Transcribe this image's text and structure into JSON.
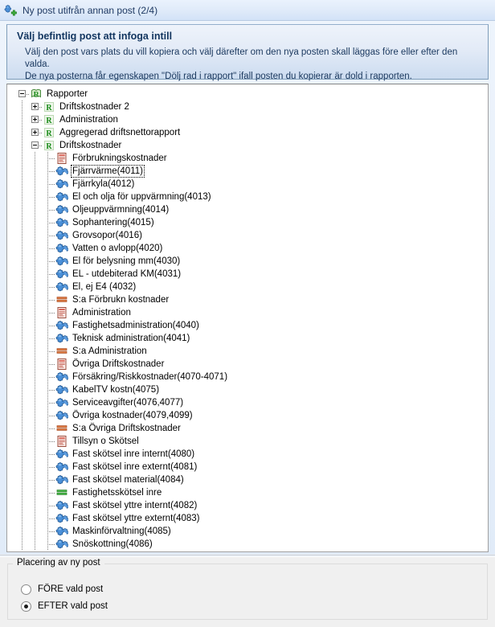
{
  "window": {
    "title": "Ny post utifrån annan post (2/4)",
    "icon": "puzzle-plus-icon"
  },
  "header": {
    "title": "Välj befintlig post att infoga intill",
    "line1": "Välj den post vars plats du vill kopiera och välj därefter om den nya posten skall läggas före eller efter den valda.",
    "line2": "De nya posterna får egenskapen \"Dölj rad i rapport\" ifall posten du kopierar är dold i rapporten."
  },
  "tree": {
    "nodes": [
      {
        "label": "Rapporter",
        "depth": 0,
        "icon": "report-root-icon",
        "expander": "minus",
        "focused": false
      },
      {
        "label": "Driftskostnader 2",
        "depth": 1,
        "icon": "report-icon",
        "expander": "plus",
        "focused": false
      },
      {
        "label": "Administration",
        "depth": 1,
        "icon": "report-icon",
        "expander": "plus",
        "focused": false
      },
      {
        "label": "Aggregerad driftsnettorapport",
        "depth": 1,
        "icon": "report-icon",
        "expander": "plus",
        "focused": false
      },
      {
        "label": "Driftskostnader",
        "depth": 1,
        "icon": "report-icon",
        "expander": "minus",
        "focused": false
      },
      {
        "label": "Förbrukningskostnader",
        "depth": 2,
        "icon": "doc-icon",
        "expander": "none",
        "focused": false
      },
      {
        "label": "Fjärrvärme(4011)",
        "depth": 2,
        "icon": "puzzle-icon",
        "expander": "none",
        "focused": true
      },
      {
        "label": "Fjärrkyla(4012)",
        "depth": 2,
        "icon": "puzzle-icon",
        "expander": "none",
        "focused": false
      },
      {
        "label": "El och olja för uppvärmning(4013)",
        "depth": 2,
        "icon": "puzzle-icon",
        "expander": "none",
        "focused": false
      },
      {
        "label": "Oljeuppvärmning(4014)",
        "depth": 2,
        "icon": "puzzle-icon",
        "expander": "none",
        "focused": false
      },
      {
        "label": "Sophantering(4015)",
        "depth": 2,
        "icon": "puzzle-icon",
        "expander": "none",
        "focused": false
      },
      {
        "label": "Grovsopor(4016)",
        "depth": 2,
        "icon": "puzzle-icon",
        "expander": "none",
        "focused": false
      },
      {
        "label": "Vatten o avlopp(4020)",
        "depth": 2,
        "icon": "puzzle-icon",
        "expander": "none",
        "focused": false
      },
      {
        "label": "El för belysning mm(4030)",
        "depth": 2,
        "icon": "puzzle-icon",
        "expander": "none",
        "focused": false
      },
      {
        "label": "EL - utdebiterad KM(4031)",
        "depth": 2,
        "icon": "puzzle-icon",
        "expander": "none",
        "focused": false
      },
      {
        "label": "El, ej E4 (4032)",
        "depth": 2,
        "icon": "puzzle-icon",
        "expander": "none",
        "focused": false
      },
      {
        "label": "S:a Förbrukn kostnader",
        "depth": 2,
        "icon": "sum-icon",
        "expander": "none",
        "focused": false
      },
      {
        "label": "Administration",
        "depth": 2,
        "icon": "doc-icon",
        "expander": "none",
        "focused": false
      },
      {
        "label": "Fastighetsadministration(4040)",
        "depth": 2,
        "icon": "puzzle-icon",
        "expander": "none",
        "focused": false
      },
      {
        "label": "Teknisk administration(4041)",
        "depth": 2,
        "icon": "puzzle-icon",
        "expander": "none",
        "focused": false
      },
      {
        "label": "S:a Administration",
        "depth": 2,
        "icon": "sum-icon",
        "expander": "none",
        "focused": false
      },
      {
        "label": "Övriga Driftskostnader",
        "depth": 2,
        "icon": "doc-icon",
        "expander": "none",
        "focused": false
      },
      {
        "label": "Försäkring/Riskkostnader(4070-4071)",
        "depth": 2,
        "icon": "puzzle-icon",
        "expander": "none",
        "focused": false
      },
      {
        "label": "KabelTV kostn(4075)",
        "depth": 2,
        "icon": "puzzle-icon",
        "expander": "none",
        "focused": false
      },
      {
        "label": "Serviceavgifter(4076,4077)",
        "depth": 2,
        "icon": "puzzle-icon",
        "expander": "none",
        "focused": false
      },
      {
        "label": "Övriga kostnader(4079,4099)",
        "depth": 2,
        "icon": "puzzle-icon",
        "expander": "none",
        "focused": false
      },
      {
        "label": "S:a Övriga Driftskostnader",
        "depth": 2,
        "icon": "sum-icon",
        "expander": "none",
        "focused": false
      },
      {
        "label": "Tillsyn o Skötsel",
        "depth": 2,
        "icon": "doc-icon",
        "expander": "none",
        "focused": false
      },
      {
        "label": "Fast skötsel inre internt(4080)",
        "depth": 2,
        "icon": "puzzle-icon",
        "expander": "none",
        "focused": false
      },
      {
        "label": "Fast skötsel inre externt(4081)",
        "depth": 2,
        "icon": "puzzle-icon",
        "expander": "none",
        "focused": false
      },
      {
        "label": "Fast skötsel material(4084)",
        "depth": 2,
        "icon": "puzzle-icon",
        "expander": "none",
        "focused": false
      },
      {
        "label": "Fastighetsskötsel inre",
        "depth": 2,
        "icon": "sum-green-icon",
        "expander": "none",
        "focused": false
      },
      {
        "label": "Fast skötsel yttre internt(4082)",
        "depth": 2,
        "icon": "puzzle-icon",
        "expander": "none",
        "focused": false
      },
      {
        "label": "Fast skötsel yttre externt(4083)",
        "depth": 2,
        "icon": "puzzle-icon",
        "expander": "none",
        "focused": false
      },
      {
        "label": "Maskinförvaltning(4085)",
        "depth": 2,
        "icon": "puzzle-icon",
        "expander": "none",
        "focused": false
      },
      {
        "label": "Snöskottning(4086)",
        "depth": 2,
        "icon": "puzzle-icon",
        "expander": "none",
        "focused": false
      }
    ]
  },
  "placement": {
    "legend": "Placering av ny post",
    "options": [
      {
        "label": "FÖRE vald post",
        "checked": false
      },
      {
        "label": "EFTER vald post",
        "checked": true
      }
    ]
  },
  "colors": {
    "titlebar_text": "#1f3a63",
    "header_text": "#12355f",
    "panel_border": "#7f9db9",
    "puzzle_blue": "#3f7fd0",
    "report_green": "#1a8a1a",
    "sum_orange": "#d2601a",
    "sum_green": "#2f9e2f"
  }
}
